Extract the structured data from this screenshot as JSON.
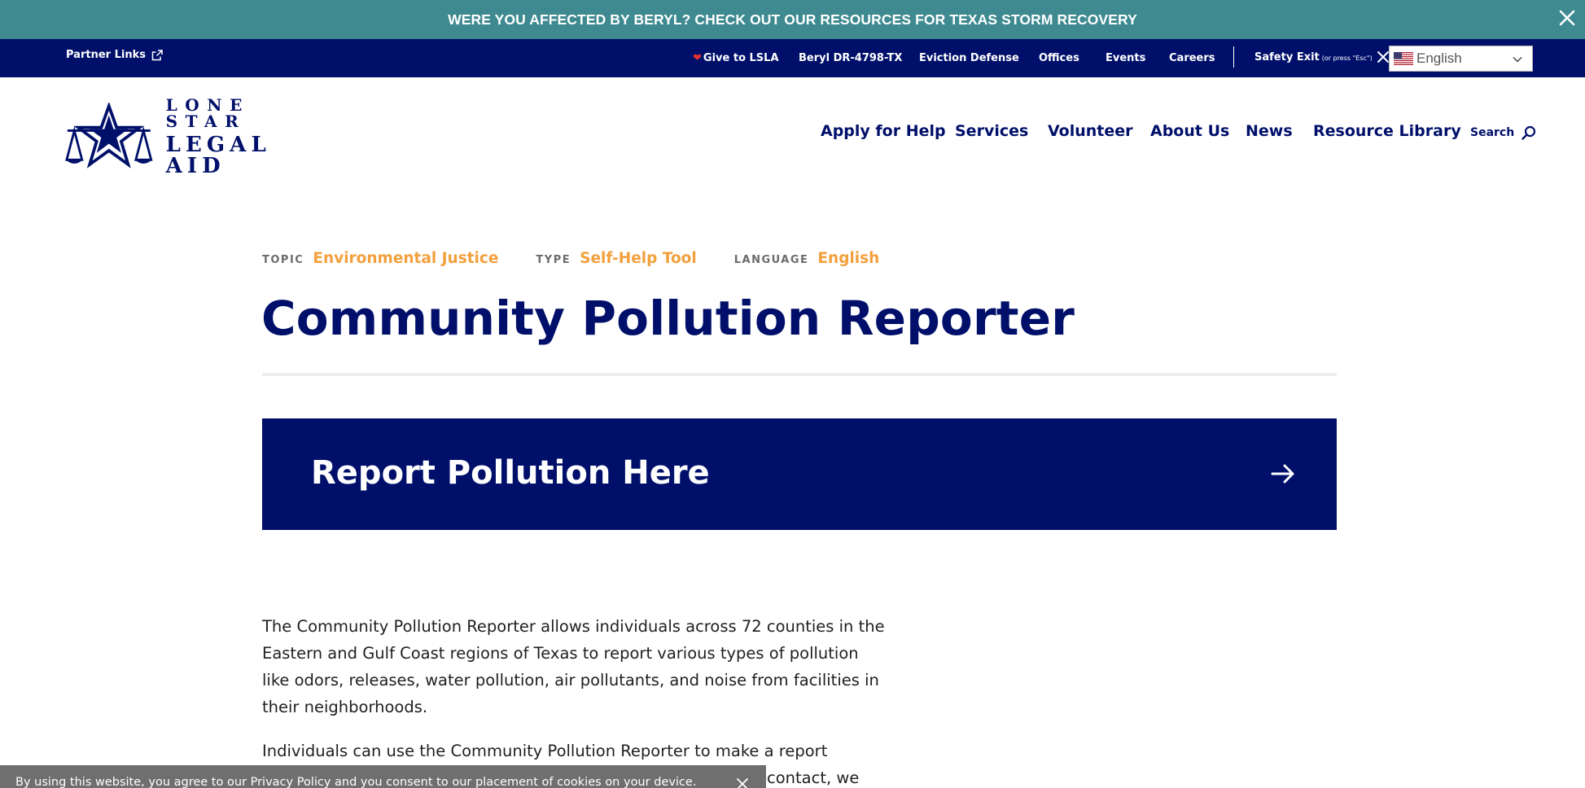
{
  "alert": {
    "text": "WERE YOU AFFECTED BY BERYL? CHECK OUT OUR RESOURCES FOR TEXAS STORM RECOVERY"
  },
  "utility": {
    "partner_links": "Partner Links",
    "links": [
      "Give to LSLA",
      "Beryl DR-4798-TX",
      "Eviction Defense",
      "Offices",
      "Events",
      "Careers"
    ],
    "safety_exit": "Safety Exit",
    "safety_exit_hint": "(or press \"Esc\")",
    "language": "English"
  },
  "logo": {
    "line1": "LONE STAR",
    "line2": "LEGAL AID"
  },
  "nav": {
    "items": [
      "Apply for Help",
      "Services",
      "Volunteer",
      "About Us",
      "News",
      "Resource Library"
    ],
    "search": "Search"
  },
  "meta": {
    "topic_label": "TOPIC",
    "topic": "Environmental Justice",
    "type_label": "TYPE",
    "type": "Self-Help Tool",
    "language_label": "LANGUAGE",
    "language": "English"
  },
  "page": {
    "title": "Community Pollution Reporter",
    "cta": "Report Pollution Here",
    "paragraphs": [
      "The Community Pollution Reporter allows individuals across 72 counties in the Eastern and Gulf Coast regions of Texas to report various types of pollution like odors, releases, water pollution, air pollutants, and noise from facilities in their neighborhoods.",
      "Individuals can use the Community Pollution Reporter to make a report"
    ],
    "paragraph2_tail": "contact, we"
  },
  "cookie": {
    "text": "By using this website, you agree to our Privacy Policy and you consent to our placement of cookies on your device."
  },
  "colors": {
    "navy": "#00106a",
    "teal": "#3e8a90",
    "orange": "#f2a03d"
  }
}
